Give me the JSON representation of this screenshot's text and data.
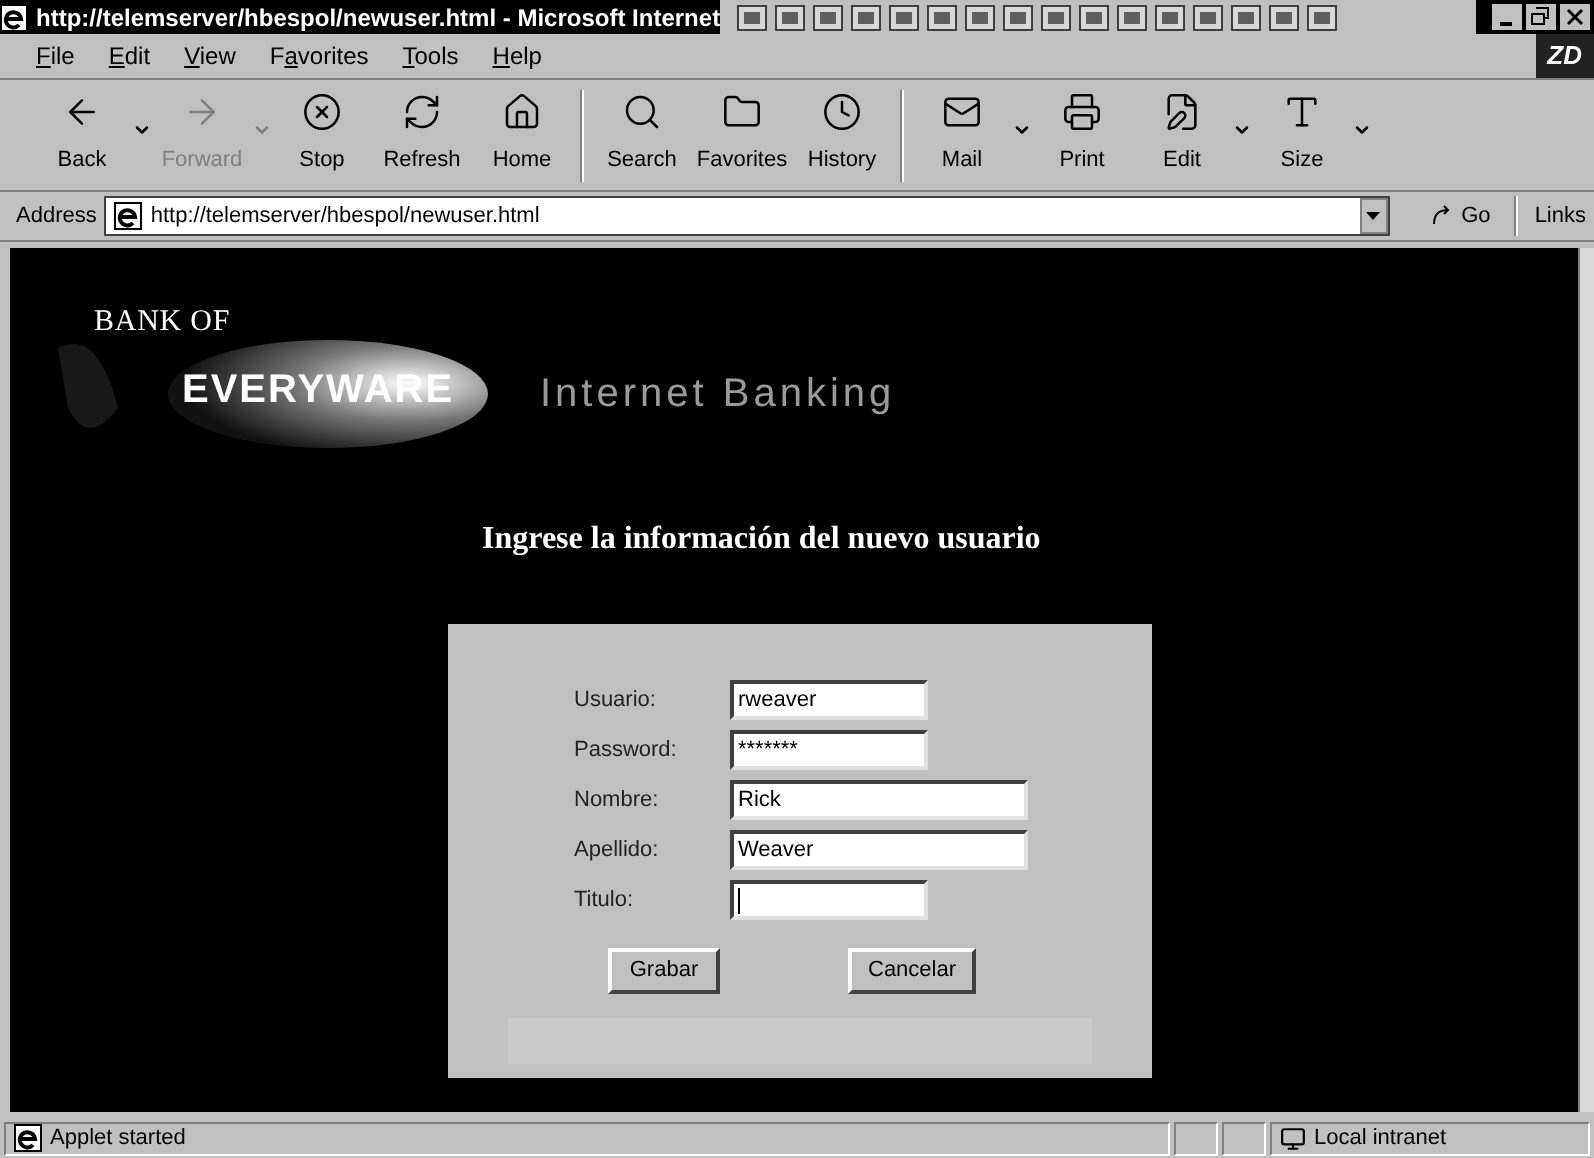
{
  "window": {
    "title": "http://telemserver/hbespol/newuser.html - Microsoft Internet"
  },
  "menu": [
    "File",
    "Edit",
    "View",
    "Favorites",
    "Tools",
    "Help"
  ],
  "brand_badge": "ZD",
  "toolbar": [
    {
      "label": "Back",
      "kind": "back",
      "disabled": false,
      "dropdown": true
    },
    {
      "label": "Forward",
      "kind": "forward",
      "disabled": true,
      "dropdown": true
    },
    {
      "label": "Stop",
      "kind": "stop",
      "disabled": false,
      "dropdown": false
    },
    {
      "label": "Refresh",
      "kind": "refresh",
      "disabled": false,
      "dropdown": false
    },
    {
      "label": "Home",
      "kind": "home",
      "disabled": false,
      "dropdown": false
    },
    {
      "label": "Search",
      "kind": "search",
      "disabled": false,
      "dropdown": false
    },
    {
      "label": "Favorites",
      "kind": "favorites",
      "disabled": false,
      "dropdown": false
    },
    {
      "label": "History",
      "kind": "history",
      "disabled": false,
      "dropdown": false
    },
    {
      "label": "Mail",
      "kind": "mail",
      "disabled": false,
      "dropdown": true
    },
    {
      "label": "Print",
      "kind": "print",
      "disabled": false,
      "dropdown": false
    },
    {
      "label": "Edit",
      "kind": "edit",
      "disabled": false,
      "dropdown": true
    },
    {
      "label": "Size",
      "kind": "size",
      "disabled": false,
      "dropdown": true
    }
  ],
  "address_bar": {
    "label": "Address",
    "value": "http://telemserver/hbespol/newuser.html",
    "go": "Go",
    "links": "Links"
  },
  "page": {
    "logo_top": "BANK OF",
    "logo_main": "EVERYWARE",
    "tagline": "Internet Banking",
    "heading": "Ingrese la información del nuevo usuario",
    "form": [
      {
        "label": "Usuario:",
        "value": "rweaver",
        "wide": false,
        "focused": false
      },
      {
        "label": "Password:",
        "value": "*******",
        "wide": false,
        "focused": false
      },
      {
        "label": "Nombre:",
        "value": "Rick",
        "wide": true,
        "focused": false
      },
      {
        "label": "Apellido:",
        "value": "Weaver",
        "wide": true,
        "focused": false
      },
      {
        "label": "Titulo:",
        "wide": false,
        "focused": true
      }
    ],
    "buttons": [
      "Grabar",
      "Cancelar"
    ]
  },
  "status_bar": {
    "message": "Applet started",
    "zone": "Local intranet"
  }
}
